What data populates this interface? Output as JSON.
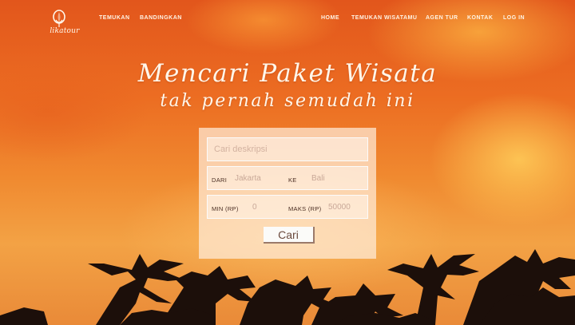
{
  "brand": {
    "logo_text": "likatour"
  },
  "nav": {
    "left": [
      {
        "label": "TEMUKAN"
      },
      {
        "label": "BANDINGKAN"
      }
    ],
    "right": [
      {
        "label": "HOME"
      },
      {
        "label": "TEMUKAN WISATAMU"
      },
      {
        "label": "AGEN TUR"
      },
      {
        "label": "KONTAK"
      },
      {
        "label": "LOG IN"
      }
    ]
  },
  "hero": {
    "headline_line1": "Mencari Paket Wisata",
    "headline_line2": "tak pernah semudah ini"
  },
  "search": {
    "description_placeholder": "Cari deskripsi",
    "from_label": "DARI",
    "from_placeholder": "Jakarta",
    "to_label": "KE",
    "to_placeholder": "Bali",
    "min_label": "MIN (RP)",
    "min_placeholder": "0",
    "max_label": "MAKS (RP)",
    "max_placeholder": "50000",
    "submit_label": "Cari"
  },
  "colors": {
    "sky_top": "#e2561c",
    "sky_mid": "#f08a30",
    "text_light": "#fff4e6",
    "panel": "#ffecda"
  },
  "icons": {
    "logo": "balloon-logo-icon"
  }
}
